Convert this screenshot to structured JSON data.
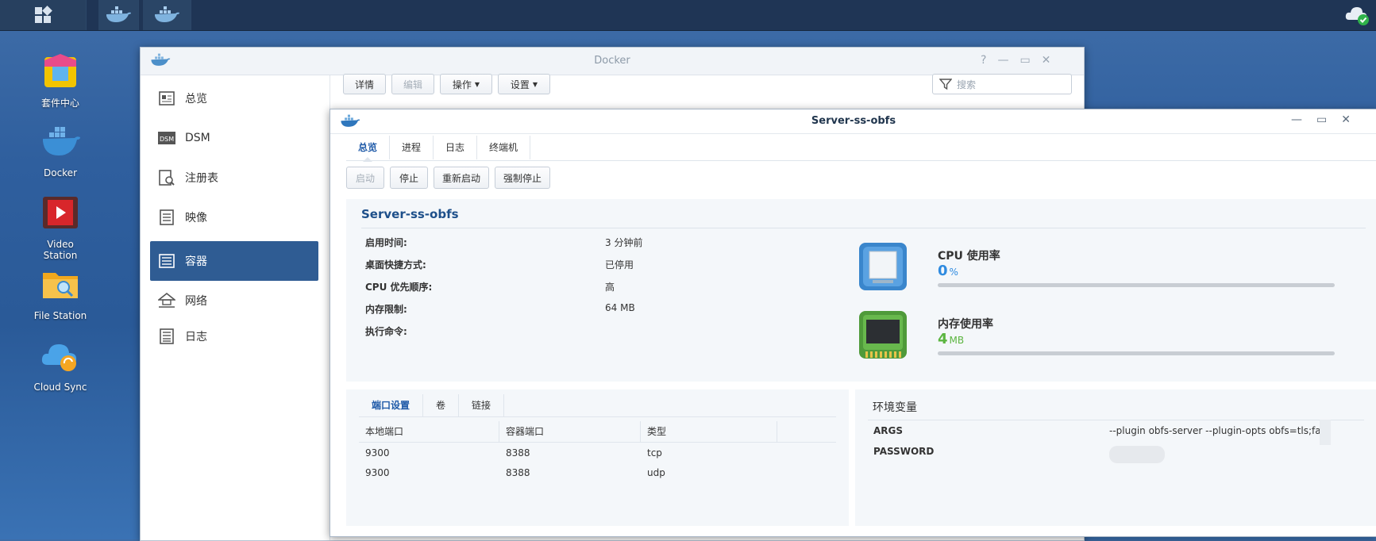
{
  "desktop": {
    "icons": [
      {
        "label": "套件中心"
      },
      {
        "label": "Docker"
      },
      {
        "label": "Video Station"
      },
      {
        "label": "File Station"
      },
      {
        "label": "Cloud Sync"
      }
    ]
  },
  "docker_window": {
    "title": "Docker",
    "sidebar": [
      {
        "label": "总览"
      },
      {
        "label": "DSM"
      },
      {
        "label": "注册表"
      },
      {
        "label": "映像"
      },
      {
        "label": "容器"
      },
      {
        "label": "网络"
      },
      {
        "label": "日志"
      }
    ],
    "toolbar": {
      "details": "详情",
      "edit": "编辑",
      "action": "操作",
      "settings": "设置",
      "search_placeholder": "搜索"
    }
  },
  "container_window": {
    "title": "Server-ss-obfs",
    "tabs": [
      "总览",
      "进程",
      "日志",
      "终端机"
    ],
    "actions": {
      "start": "启动",
      "stop": "停止",
      "restart": "重新启动",
      "force_stop": "强制停止"
    },
    "overview": {
      "name": "Server-ss-obfs",
      "fields": [
        {
          "key": "启用时间:",
          "value": "3 分钟前"
        },
        {
          "key": "桌面快捷方式:",
          "value": "已停用"
        },
        {
          "key": "CPU 优先顺序:",
          "value": "高"
        },
        {
          "key": "内存限制:",
          "value": "64 MB"
        },
        {
          "key": "执行命令:",
          "value": ""
        }
      ],
      "cpu": {
        "label": "CPU 使用率",
        "value": "0",
        "unit": "%",
        "usage_fraction": 0.0,
        "color": "#2f8be0"
      },
      "memory": {
        "label": "内存使用率",
        "value": "4",
        "unit": "MB",
        "usage_fraction": 0.0,
        "color": "#5bb540"
      }
    },
    "ports": {
      "subtabs": [
        "端口设置",
        "卷",
        "链接"
      ],
      "headers": [
        "本地端口",
        "容器端口",
        "类型"
      ],
      "rows": [
        [
          "9300",
          "8388",
          "tcp"
        ],
        [
          "9300",
          "8388",
          "udp"
        ]
      ]
    },
    "env": {
      "title": "环境变量",
      "rows": [
        {
          "key": "ARGS",
          "value": "--plugin obfs-server --plugin-opts obfs=tls;failover="
        },
        {
          "key": "PASSWORD",
          "value": ""
        }
      ]
    }
  }
}
